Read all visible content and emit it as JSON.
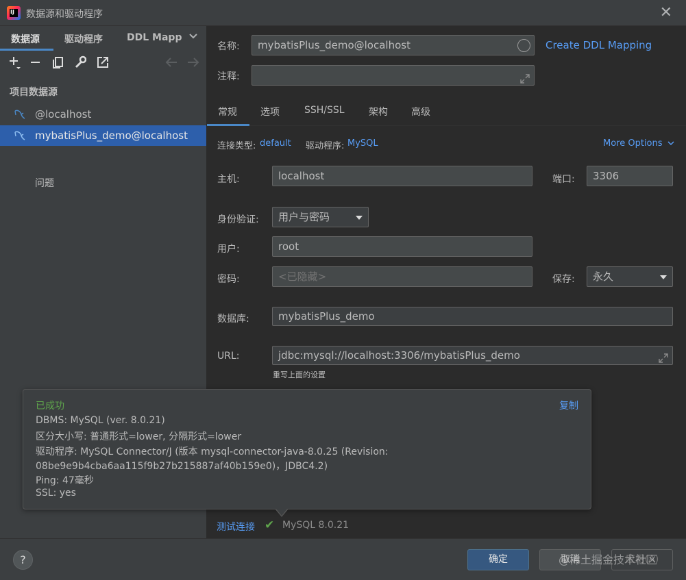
{
  "window": {
    "title": "数据源和驱动程序",
    "close_icon": "close-icon"
  },
  "left": {
    "tabs": [
      "数据源",
      "驱动程序",
      "DDL Mapp"
    ],
    "section_title": "项目数据源",
    "items": [
      "@localhost",
      "mybatisPlus_demo@localhost"
    ],
    "problems": "问题"
  },
  "form": {
    "name_label": "名称:",
    "name_value": "mybatisPlus_demo@localhost",
    "create_ddl_link": "Create DDL Mapping",
    "comment_label": "注释:",
    "comment_value": "",
    "tabs": [
      "常规",
      "选项",
      "SSH/SSL",
      "架构",
      "高级"
    ],
    "conn_type_label": "连接类型:",
    "conn_type_value": "default",
    "driver_label": "驱动程序:",
    "driver_value": "MySQL",
    "more_options": "More Options",
    "host_label": "主机:",
    "host_value": "localhost",
    "port_label": "端口:",
    "port_value": "3306",
    "auth_label": "身份验证:",
    "auth_value": "用户与密码",
    "user_label": "用户:",
    "user_value": "root",
    "password_label": "密码:",
    "password_placeholder": "<已隐藏>",
    "save_label": "保存:",
    "save_value": "永久",
    "database_label": "数据库:",
    "database_value": "mybatisPlus_demo",
    "url_label": "URL:",
    "url_value": "jdbc:mysql://localhost:3306/mybatisPlus_demo",
    "url_hint": "重写上面的设置"
  },
  "popup": {
    "title": "已成功",
    "copy": "复制",
    "lines": [
      "DBMS: MySQL (ver. 8.0.21)",
      "区分大小写: 普通形式=lower, 分隔形式=lower",
      "驱动程序: MySQL Connector/J (版本 mysql-connector-java-8.0.25 (Revision:",
      "08be9e9b4cba6aa115f9b27b215887af40b159e0)，JDBC4.2)",
      "Ping: 47毫秒",
      "SSL: yes"
    ]
  },
  "status": {
    "test_link": "测试连接",
    "version": "MySQL 8.0.21"
  },
  "buttons": {
    "help": "?",
    "ok": "确定",
    "cancel": "取消",
    "apply": "应用(A)"
  },
  "watermark": "@稀土掘金技术社区",
  "colors": {
    "accent": "#4a88c7",
    "link": "#589df6",
    "success": "#5fa54c",
    "selection": "#2d5fab"
  }
}
